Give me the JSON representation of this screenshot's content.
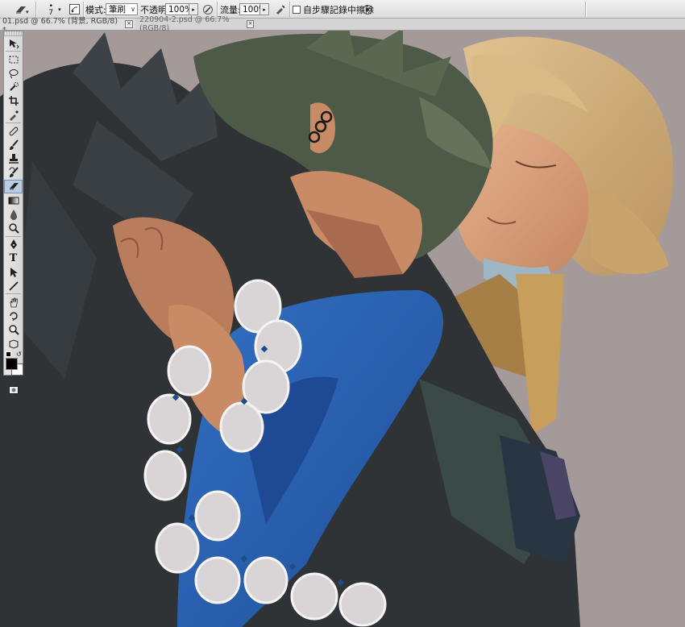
{
  "options_bar": {
    "brush_size": "7",
    "mode_label": "模式:",
    "mode_value": "筆刷",
    "opacity_label": "不透明:",
    "opacity_value": "100%",
    "flow_label": "流量:",
    "flow_value": "100%",
    "erase_to_history_label": "自步驟記錄中擦除",
    "erase_to_history_checked": false
  },
  "tabs": [
    {
      "label": "01.psd @ 66.7% (背景, RGB/8) *",
      "active": true
    },
    {
      "label": "220904-2.psd @ 66.7% (RGB/8)",
      "active": false
    }
  ],
  "tab_close_glyph": "×",
  "tools": [
    "move-tool-icon",
    "marquee-tool-icon",
    "lasso-tool-icon",
    "quick-select-tool-icon",
    "crop-tool-icon",
    "eyedropper-tool-icon",
    "healing-brush-tool-icon",
    "brush-tool-icon",
    "clone-stamp-tool-icon",
    "history-brush-tool-icon",
    "eraser-tool-icon",
    "gradient-tool-icon",
    "blur-tool-icon",
    "dodge-tool-icon",
    "pen-tool-icon",
    "type-tool-icon",
    "path-select-tool-icon",
    "line-tool-icon",
    "hand-tool-icon",
    "rotate-view-tool-icon",
    "zoom-tool-icon",
    "3d-tool-icon"
  ],
  "type_tool_glyph": "T",
  "active_tool": "eraser-tool-icon",
  "colors": {
    "foreground": "#000000",
    "background": "#ffffff",
    "canvas_bg": "#a39a99",
    "coat": "#2f3336",
    "sleeve_blue": "#2a5fb0",
    "hair_green": "#4e5a48",
    "hair_blonde": "#d2b27c",
    "skin": "#d79a74",
    "ruffle": "#d9d5d6"
  }
}
